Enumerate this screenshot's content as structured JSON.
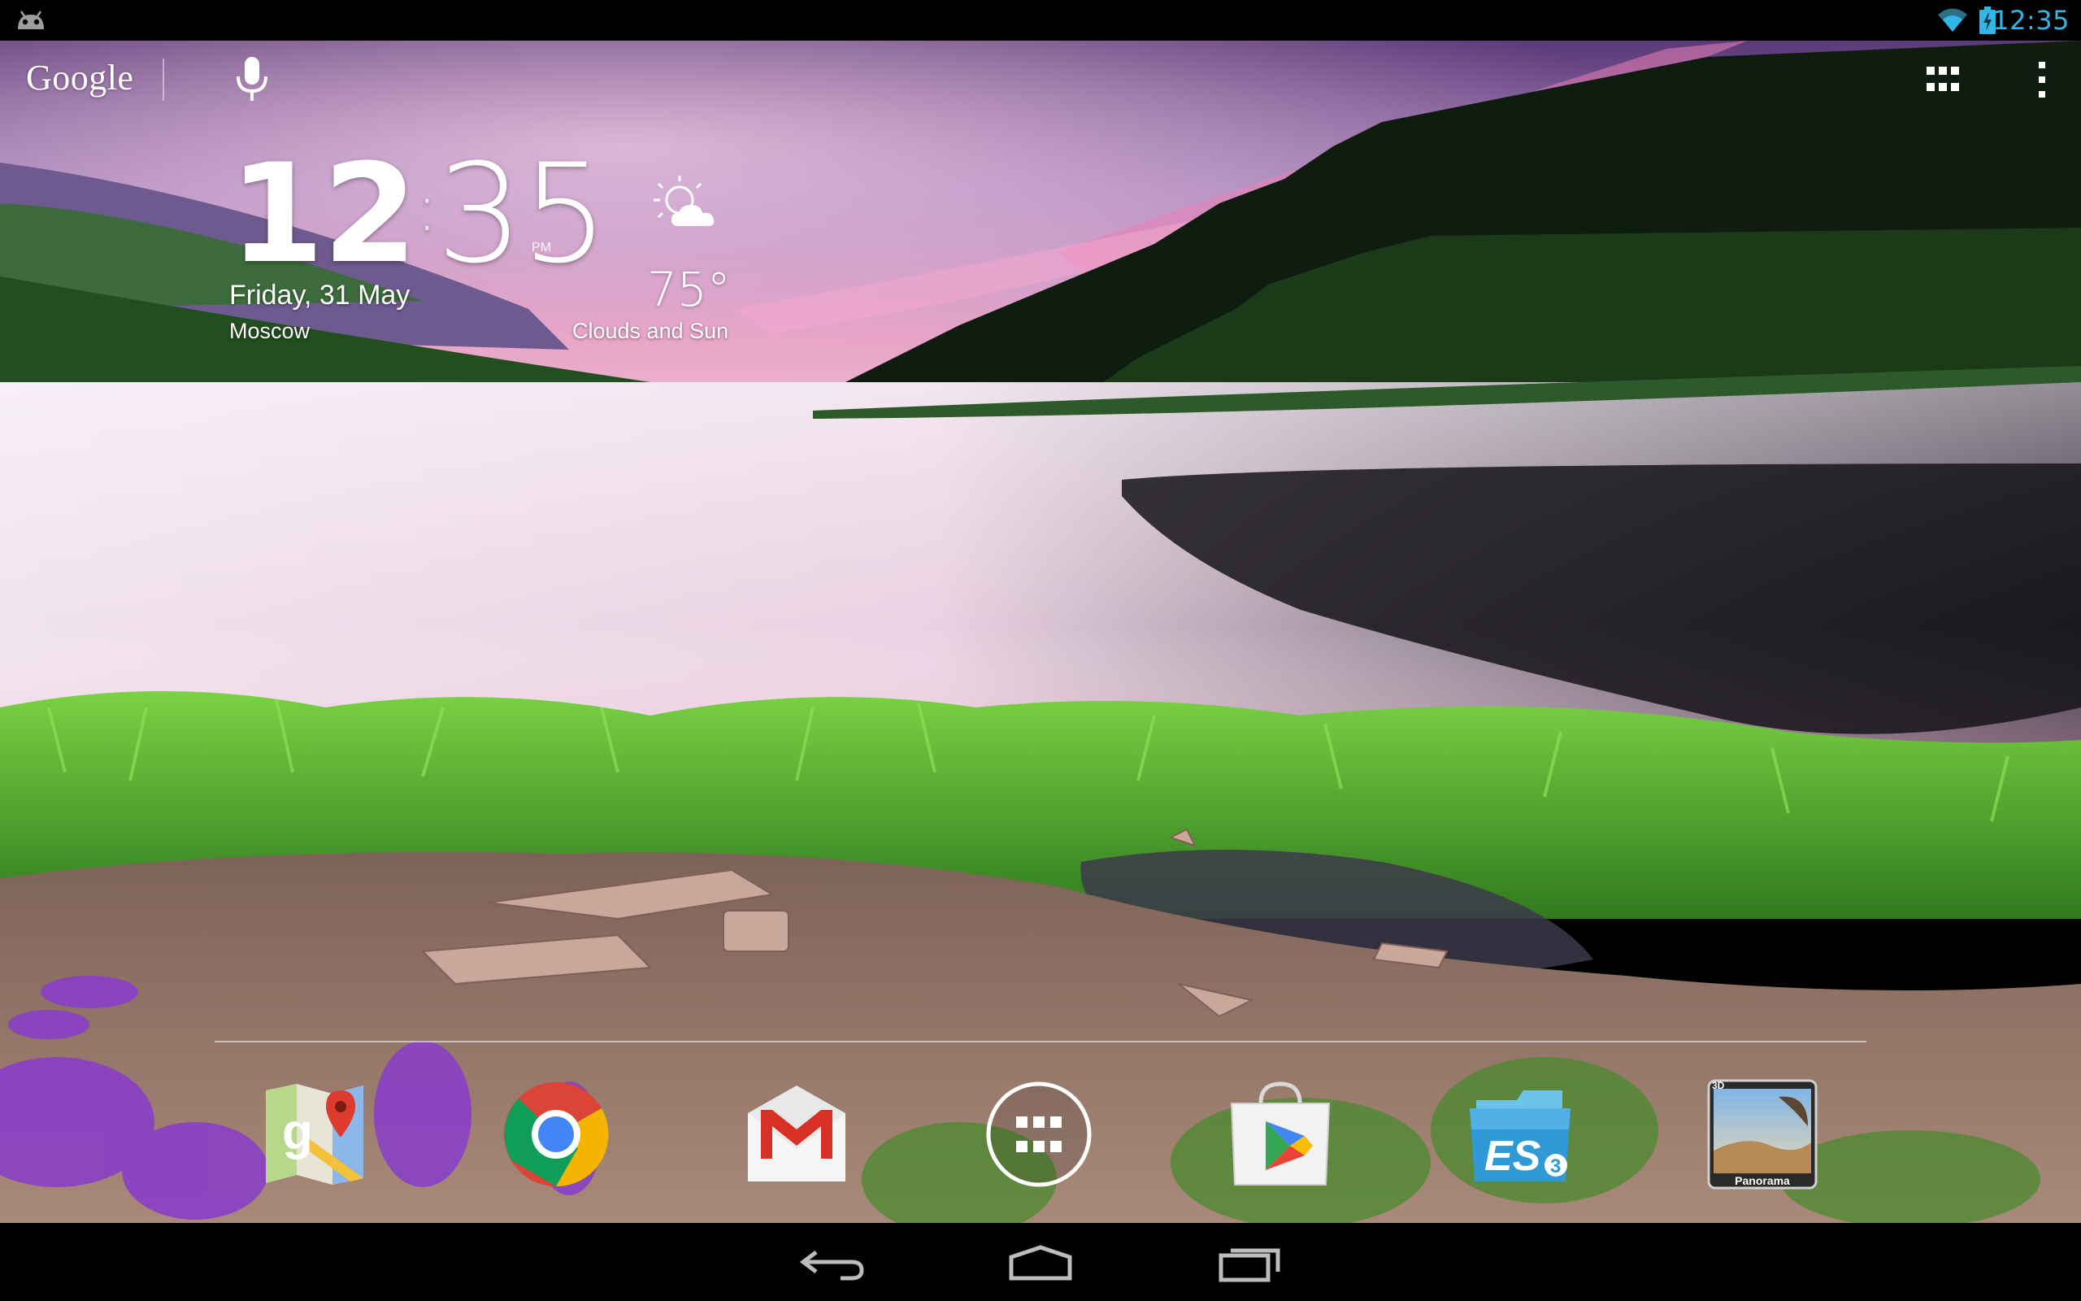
{
  "status_bar": {
    "time": "12:35",
    "icons": [
      "android-debug-icon",
      "wifi-icon",
      "battery-charging-icon"
    ],
    "accent_color": "#33b5e5"
  },
  "search_bar": {
    "logo_text": "Google",
    "icons": [
      "microphone-icon",
      "apps-grid-icon",
      "overflow-menu-icon"
    ]
  },
  "clock_widget": {
    "hours": "12",
    "separator": ":",
    "minutes": "35",
    "ampm": "PM",
    "date": "Friday, 31 May",
    "city": "Moscow"
  },
  "weather_widget": {
    "icon": "partly-cloudy-icon",
    "temperature": "75°",
    "condition": "Clouds and Sun"
  },
  "dock": {
    "apps": [
      {
        "name": "Maps",
        "icon": "maps-icon"
      },
      {
        "name": "Chrome",
        "icon": "chrome-icon"
      },
      {
        "name": "Gmail",
        "icon": "gmail-icon"
      },
      {
        "name": "All apps",
        "icon": "all-apps-icon"
      },
      {
        "name": "Play Store",
        "icon": "play-store-icon"
      },
      {
        "name": "ES File Explorer",
        "icon": "es-file-explorer-icon",
        "badge": "ES3"
      },
      {
        "name": "Panorama",
        "icon": "panorama-icon",
        "label": "Panorama",
        "badge": "3D"
      }
    ]
  },
  "nav_bar": {
    "buttons": [
      "back-icon",
      "home-icon",
      "recent-apps-icon"
    ]
  }
}
